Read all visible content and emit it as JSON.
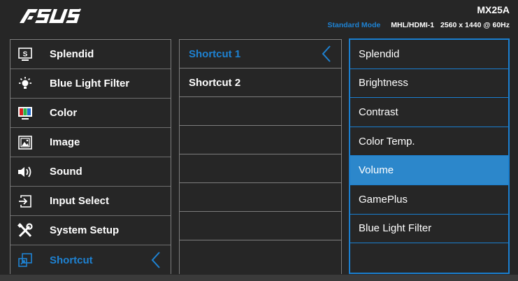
{
  "header": {
    "brand": "ASUS",
    "model": "MX25A",
    "mode": "Standard Mode",
    "input": "MHL/HDMI-1",
    "resolution": "2560 x 1440 @ 60Hz"
  },
  "colors": {
    "accent": "#1e82d2",
    "highlight": "#2c87cb",
    "border": "#7d7d7d",
    "background": "#262626"
  },
  "main_menu": [
    {
      "label": "Splendid",
      "icon": "splendid-icon"
    },
    {
      "label": "Blue Light Filter",
      "icon": "blue-light-icon"
    },
    {
      "label": "Color",
      "icon": "color-icon"
    },
    {
      "label": "Image",
      "icon": "image-icon"
    },
    {
      "label": "Sound",
      "icon": "speaker-icon"
    },
    {
      "label": "Input Select",
      "icon": "input-select-icon"
    },
    {
      "label": "System Setup",
      "icon": "tools-icon"
    },
    {
      "label": "Shortcut",
      "icon": "shortcut-icon",
      "active": true
    }
  ],
  "sub_menu": [
    {
      "label": "Shortcut 1",
      "active": true
    },
    {
      "label": "Shortcut 2"
    },
    {
      "label": ""
    },
    {
      "label": ""
    },
    {
      "label": ""
    },
    {
      "label": ""
    },
    {
      "label": ""
    },
    {
      "label": ""
    }
  ],
  "options": [
    {
      "label": "Splendid"
    },
    {
      "label": "Brightness"
    },
    {
      "label": "Contrast"
    },
    {
      "label": "Color Temp."
    },
    {
      "label": "Volume",
      "selected": true
    },
    {
      "label": "GamePlus"
    },
    {
      "label": "Blue Light Filter"
    },
    {
      "label": ""
    }
  ]
}
